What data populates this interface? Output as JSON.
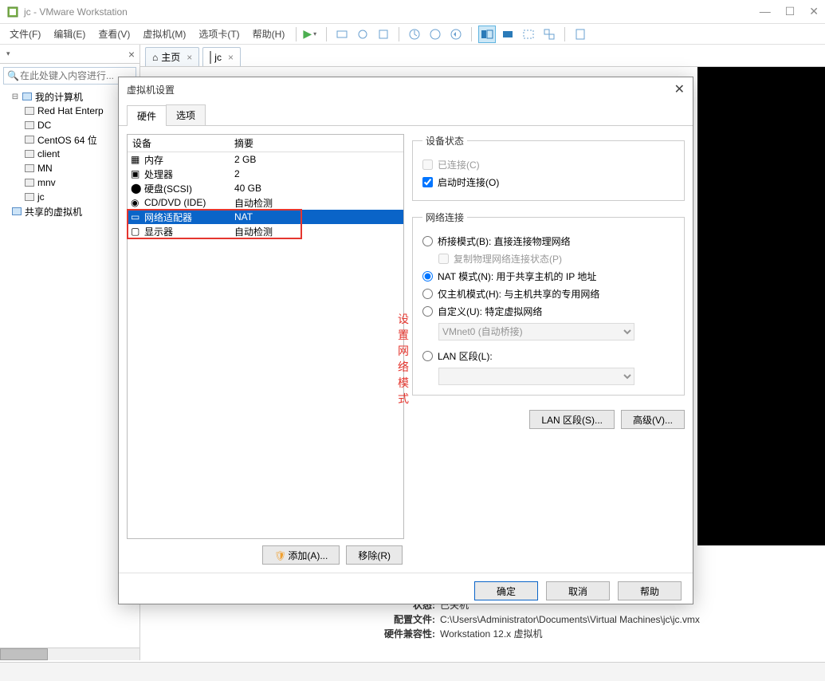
{
  "titlebar": {
    "text": "jc - VMware Workstation"
  },
  "menu": {
    "file": "文件(F)",
    "edit": "编辑(E)",
    "view": "查看(V)",
    "vm": "虚拟机(M)",
    "tabs": "选项卡(T)",
    "help": "帮助(H)"
  },
  "sidebar": {
    "search_placeholder": "在此处键入内容进行...",
    "root": "我的计算机",
    "items": [
      "Red Hat Enterp",
      "DC",
      "CentOS 64 位",
      "client",
      "MN",
      "mnv",
      "jc"
    ],
    "shared": "共享的虚拟机"
  },
  "tabs": {
    "home": "主页",
    "jc": "jc"
  },
  "dialog": {
    "title": "虚拟机设置",
    "tab_hw": "硬件",
    "tab_opt": "选项",
    "col_device": "设备",
    "col_summary": "摘要",
    "devices": [
      {
        "name": "内存",
        "summary": "2 GB"
      },
      {
        "name": "处理器",
        "summary": "2"
      },
      {
        "name": "硬盘(SCSI)",
        "summary": "40 GB"
      },
      {
        "name": "CD/DVD (IDE)",
        "summary": "自动检测"
      },
      {
        "name": "网络适配器",
        "summary": "NAT"
      },
      {
        "name": "显示器",
        "summary": "自动检测"
      }
    ],
    "annotation": "设置网络模式",
    "add_btn": "添加(A)...",
    "remove_btn": "移除(R)",
    "status_group": "设备状态",
    "connected": "已连接(C)",
    "connect_on": "启动时连接(O)",
    "net_group": "网络连接",
    "bridged": "桥接模式(B): 直接连接物理网络",
    "replicate": "复制物理网络连接状态(P)",
    "nat": "NAT 模式(N): 用于共享主机的 IP 地址",
    "hostonly": "仅主机模式(H): 与主机共享的专用网络",
    "custom": "自定义(U): 特定虚拟网络",
    "vmnet": "VMnet0 (自动桥接)",
    "lan": "LAN 区段(L):",
    "lan_btn": "LAN 区段(S)...",
    "adv_btn": "高级(V)...",
    "ok": "确定",
    "cancel": "取消",
    "help_btn": "帮助"
  },
  "status": {
    "state_lbl": "状态:",
    "state": "已关机",
    "cfg_lbl": "配置文件:",
    "cfg": "C:\\Users\\Administrator\\Documents\\Virtual Machines\\jc\\jc.vmx",
    "compat_lbl": "硬件兼容性:",
    "compat": "Workstation 12.x 虚拟机"
  }
}
